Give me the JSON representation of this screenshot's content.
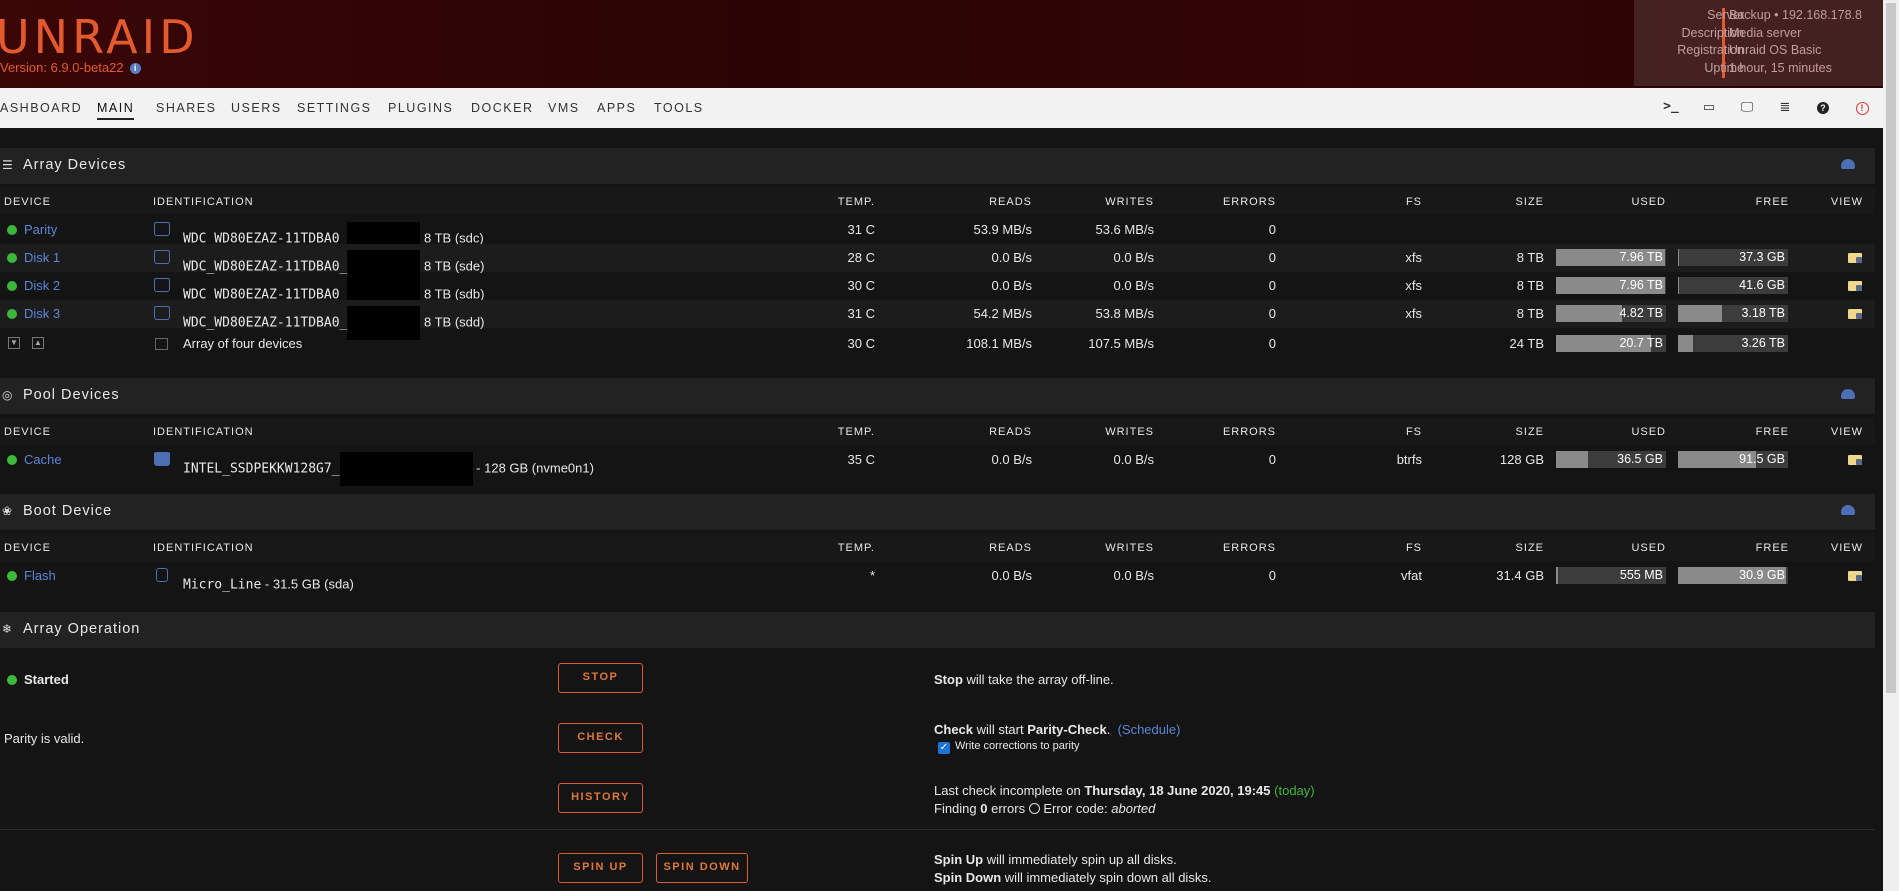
{
  "header": {
    "logo": "UNRAID",
    "version": "Version: 6.9.0-beta22",
    "server": {
      "labels": [
        "Server",
        "Description",
        "Registration",
        "Uptime"
      ],
      "values": [
        "Backup • 192.168.178.8",
        "Media server",
        "Unraid OS Basic",
        "1 hour, 15 minutes"
      ]
    }
  },
  "nav": {
    "items": [
      "ASHBOARD",
      "MAIN",
      "SHARES",
      "USERS",
      "SETTINGS",
      "PLUGINS",
      "DOCKER",
      "VMS",
      "APPS",
      "TOOLS"
    ],
    "active": "MAIN",
    "icons": [
      "terminal-icon",
      "feedback-icon",
      "monitor-icon",
      "log-icon",
      "help-icon",
      "power-icon"
    ]
  },
  "columns": [
    "DEVICE",
    "IDENTIFICATION",
    "TEMP.",
    "READS",
    "WRITES",
    "ERRORS",
    "FS",
    "SIZE",
    "USED",
    "FREE",
    "VIEW"
  ],
  "array": {
    "title": "Array Devices",
    "rows": [
      {
        "device": "Parity",
        "id": "WDC_WD80EZAZ-11TDBA0_",
        "id_suffix": "8 TB (sdc)",
        "temp": "31 C",
        "reads": "53.9 MB/s",
        "writes": "53.6 MB/s",
        "errors": "0",
        "fs": "",
        "size": "",
        "used": "",
        "free": "",
        "used_pct": 0,
        "free_pct": 0
      },
      {
        "device": "Disk 1",
        "id": "WDC_WD80EZAZ-11TDBA0_",
        "id_suffix": "8 TB (sde)",
        "temp": "28 C",
        "reads": "0.0 B/s",
        "writes": "0.0 B/s",
        "errors": "0",
        "fs": "xfs",
        "size": "8 TB",
        "used": "7.96 TB",
        "free": "37.3 GB",
        "used_pct": 99.5,
        "free_pct": 0.5
      },
      {
        "device": "Disk 2",
        "id": "WDC_WD80EZAZ-11TDBA0_",
        "id_suffix": "8 TB (sdb)",
        "temp": "30 C",
        "reads": "0.0 B/s",
        "writes": "0.0 B/s",
        "errors": "0",
        "fs": "xfs",
        "size": "8 TB",
        "used": "7.96 TB",
        "free": "41.6 GB",
        "used_pct": 99.5,
        "free_pct": 0.5
      },
      {
        "device": "Disk 3",
        "id": "WDC_WD80EZAZ-11TDBA0_",
        "id_suffix": "8 TB (sdd)",
        "temp": "31 C",
        "reads": "54.2 MB/s",
        "writes": "53.8 MB/s",
        "errors": "0",
        "fs": "xfs",
        "size": "8 TB",
        "used": "4.82 TB",
        "free": "3.18 TB",
        "used_pct": 60,
        "free_pct": 40
      }
    ],
    "summary": {
      "label": "Array of four devices",
      "temp": "30 C",
      "reads": "108.1 MB/s",
      "writes": "107.5 MB/s",
      "errors": "0",
      "size": "24 TB",
      "used": "20.7 TB",
      "free": "3.26 TB",
      "used_pct": 86,
      "free_pct": 14
    }
  },
  "pool": {
    "title": "Pool Devices",
    "rows": [
      {
        "device": "Cache",
        "id": "INTEL_SSDPEKKW128G7_",
        "id_suffix": "- 128 GB (nvme0n1)",
        "temp": "35 C",
        "reads": "0.0 B/s",
        "writes": "0.0 B/s",
        "errors": "0",
        "fs": "btrfs",
        "size": "128 GB",
        "used": "36.5 GB",
        "free": "91.5 GB",
        "used_pct": 29,
        "free_pct": 71
      }
    ]
  },
  "boot": {
    "title": "Boot Device",
    "rows": [
      {
        "device": "Flash",
        "id": "Micro_Line",
        "id_suffix": "- 31.5 GB (sda)",
        "temp": "*",
        "reads": "0.0 B/s",
        "writes": "0.0 B/s",
        "errors": "0",
        "fs": "vfat",
        "size": "31.4 GB",
        "used": "555 MB",
        "free": "30.9 GB",
        "used_pct": 2,
        "free_pct": 98
      }
    ]
  },
  "operation": {
    "title": "Array Operation",
    "status": "Started",
    "parity": "Parity is valid.",
    "buttons": {
      "stop": "STOP",
      "check": "CHECK",
      "history": "HISTORY",
      "spin_up": "SPIN UP",
      "spin_down": "SPIN DOWN"
    },
    "stop_bold": "Stop",
    "stop_text": "will take the array off-line.",
    "check_bold": "Check",
    "check_mid": "will start",
    "check_bold2": "Parity-Check",
    "check_end": ".",
    "schedule": "(Schedule)",
    "write_corrections": "Write corrections to parity",
    "last_check_pre": "Last check incomplete on",
    "last_check_date": "Thursday, 18 June 2020, 19:45",
    "today": "(today)",
    "finding_pre": "Finding",
    "finding_count": "0",
    "finding_post": "errors",
    "error_code_label": "Error code:",
    "error_code": "aborted",
    "spin_up_bold": "Spin Up",
    "spin_up_text": "will immediately spin up all disks.",
    "spin_down_bold": "Spin Down",
    "spin_down_text": "will immediately spin down all disks."
  }
}
